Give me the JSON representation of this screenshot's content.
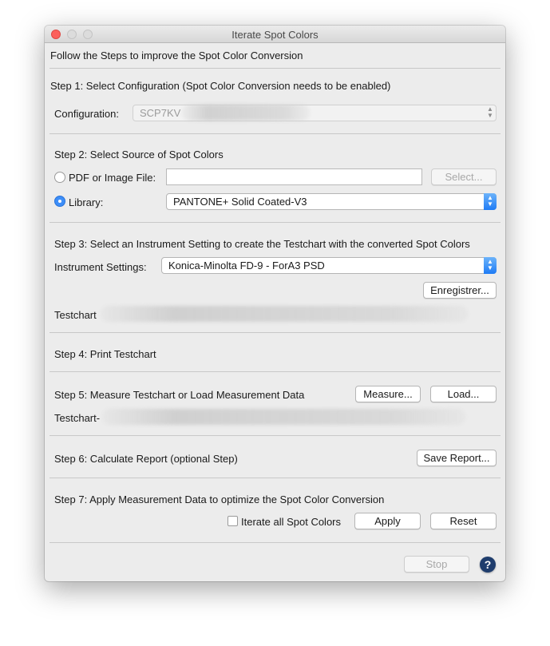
{
  "window": {
    "title": "Iterate Spot Colors"
  },
  "intro": "Follow the Steps to improve the Spot Color Conversion",
  "step1": {
    "heading": "Step 1: Select Configuration (Spot Color Conversion needs to be enabled)",
    "config_label": "Configuration:",
    "config_value": "SCP7KV"
  },
  "step2": {
    "heading": "Step 2: Select Source of Spot Colors",
    "pdf_label": "PDF or Image File:",
    "pdf_value": "",
    "select_button": "Select...",
    "library_label": "Library:",
    "library_value": "PANTONE+ Solid Coated-V3"
  },
  "step3": {
    "heading": "Step 3: Select an Instrument Setting to create the Testchart with the converted Spot Colors",
    "instrument_label": "Instrument Settings:",
    "instrument_value": "Konica-Minolta FD-9 - ForA3 PSD",
    "save_button": "Enregistrer...",
    "testchart_label": "Testchart"
  },
  "step4": {
    "heading": "Step 4: Print Testchart"
  },
  "step5": {
    "heading": "Step 5: Measure Testchart or Load Measurement Data",
    "measure_button": "Measure...",
    "load_button": "Load...",
    "testchart_label": "Testchart-"
  },
  "step6": {
    "heading": "Step 6: Calculate Report (optional Step)",
    "save_report_button": "Save Report..."
  },
  "step7": {
    "heading": "Step 7: Apply Measurement Data to optimize the Spot Color Conversion",
    "iterate_label": "Iterate all Spot Colors",
    "apply_button": "Apply",
    "reset_button": "Reset"
  },
  "footer": {
    "stop_button": "Stop",
    "help": "?"
  },
  "colors": {
    "accent": "#1f7cf5",
    "close": "#fc605c"
  }
}
